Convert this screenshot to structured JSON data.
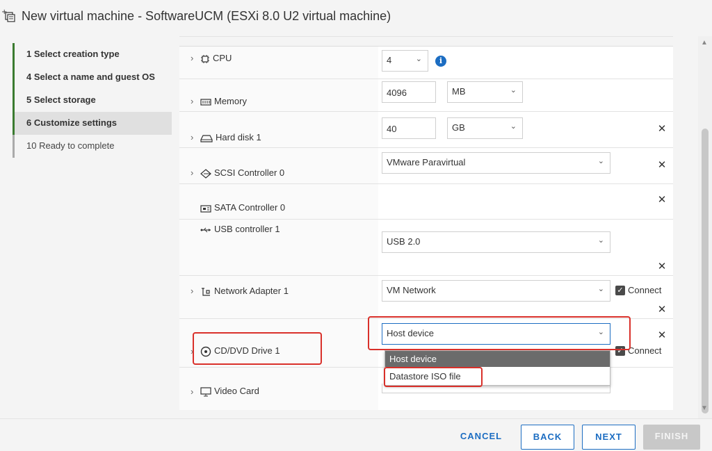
{
  "window": {
    "title": "New virtual machine - SoftwareUCM (ESXi 8.0 U2 virtual machine)"
  },
  "steps": [
    {
      "label": "1  Select creation type",
      "state": "done"
    },
    {
      "label": "4  Select a name and guest OS",
      "state": "done"
    },
    {
      "label": "5  Select storage",
      "state": "done"
    },
    {
      "label": "6  Customize settings",
      "state": "current"
    },
    {
      "label": "10  Ready to complete",
      "state": "pending"
    }
  ],
  "hardware": {
    "cpu": {
      "label": "CPU",
      "value": "4"
    },
    "memory": {
      "label": "Memory",
      "value": "4096",
      "unit": "MB"
    },
    "hard_disk": {
      "label": "Hard disk 1",
      "value": "40",
      "unit": "GB"
    },
    "scsi": {
      "label": "SCSI Controller 0",
      "value": "VMware Paravirtual"
    },
    "sata": {
      "label": "SATA Controller 0"
    },
    "usb": {
      "label": "USB controller 1",
      "value": "USB 2.0"
    },
    "network": {
      "label": "Network Adapter 1",
      "value": "VM Network",
      "connect_label": "Connect"
    },
    "cdrom": {
      "label": "CD/DVD Drive 1",
      "value": "Host device",
      "connect_label": "Connect"
    },
    "video": {
      "label": "Video Card"
    }
  },
  "dropdown": {
    "options": [
      "Host device",
      "Datastore ISO file"
    ],
    "selected": "Host device"
  },
  "footer": {
    "cancel": "CANCEL",
    "back": "BACK",
    "next": "NEXT",
    "finish": "FINISH"
  },
  "colors": {
    "accent": "#1c6dc2",
    "step_done": "#3a7b2f",
    "highlight": "#d9302a"
  }
}
